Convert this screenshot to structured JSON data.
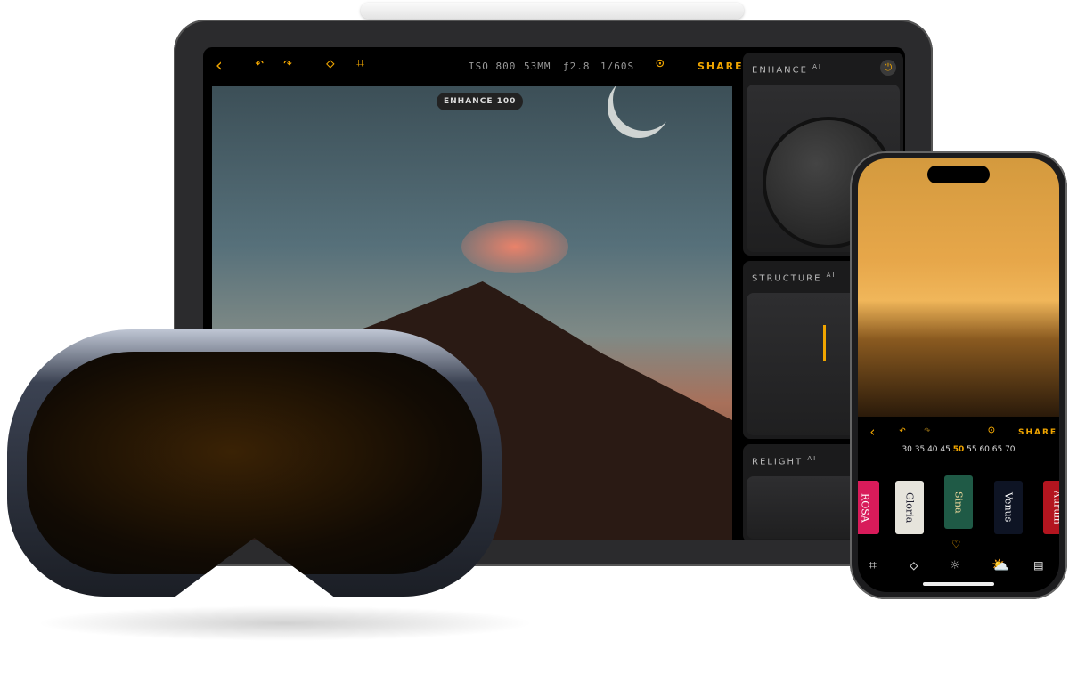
{
  "ipad": {
    "toolbar": {
      "back_icon": "chevron-left",
      "undo_icon": "undo",
      "redo_icon": "redo",
      "erase_icon": "eraser",
      "crop_icon": "crop",
      "iso": "ISO 800",
      "focal": "53MM",
      "aperture": "ƒ2.8",
      "shutter": "1/60S",
      "more_icon": "ellipsis-circle",
      "share": "SHARE"
    },
    "photo_badge": "ENHANCE 100",
    "panels": [
      {
        "label": "ENHANCE",
        "sup": "AI",
        "power_icon": "power"
      },
      {
        "label": "STRUCTURE",
        "sup": "AI"
      },
      {
        "label": "RELIGHT",
        "sup": "AI"
      }
    ]
  },
  "phone": {
    "toolbar": {
      "back_icon": "chevron-left",
      "undo_icon": "undo",
      "redo_icon": "redo",
      "more_icon": "ellipsis-circle",
      "share": "SHARE"
    },
    "scale_left": "30 35 40 45",
    "scale_selected": "50",
    "scale_right": "55 60 65 70",
    "films": [
      "ROSA",
      "Gloria",
      "Sina",
      "Venus",
      "Aurum"
    ],
    "film_colors": [
      "#d81b5a",
      "#e6e4dc",
      "#1f5a46",
      "#0e1424",
      "#b3151f"
    ],
    "favorite_icon": "heart",
    "bottom_icons": [
      "crop",
      "eraser",
      "light",
      "weather",
      "film"
    ],
    "accent": "#f0a500"
  }
}
